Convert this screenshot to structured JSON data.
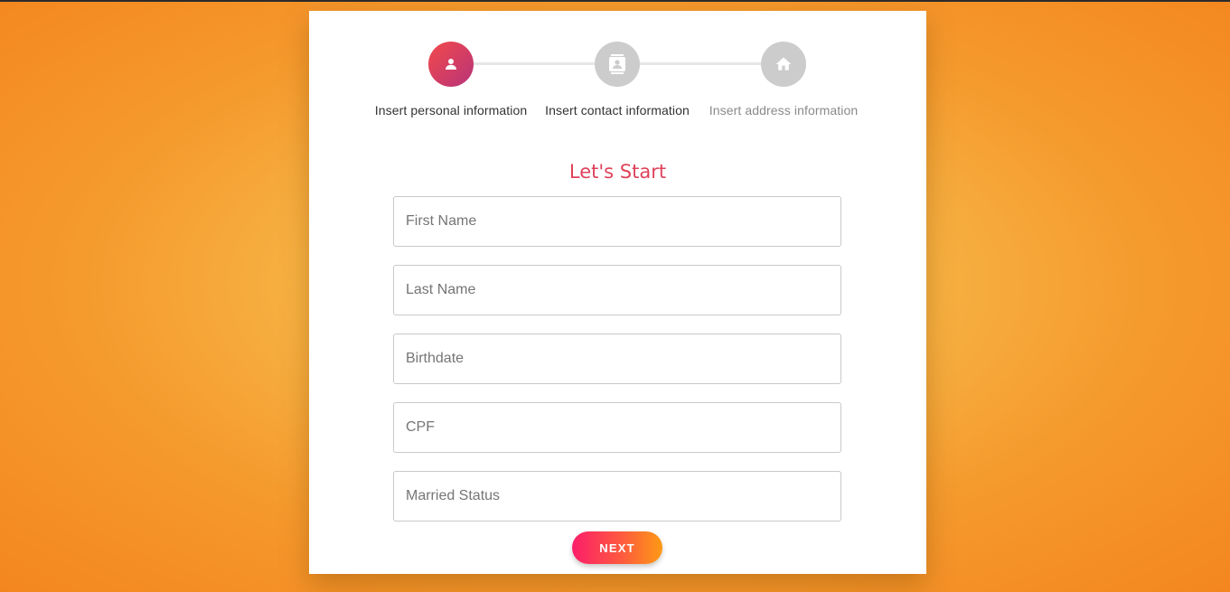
{
  "stepper": {
    "steps": [
      {
        "label": "Insert personal information",
        "icon": "person-icon",
        "state": "active"
      },
      {
        "label": "Insert contact information",
        "icon": "contact-card-icon",
        "state": "upcoming"
      },
      {
        "label": "Insert address information",
        "icon": "home-icon",
        "state": "upcoming"
      }
    ]
  },
  "form": {
    "title": "Let's Start",
    "fields": [
      {
        "name": "first-name",
        "placeholder": "First Name",
        "value": ""
      },
      {
        "name": "last-name",
        "placeholder": "Last Name",
        "value": ""
      },
      {
        "name": "birthdate",
        "placeholder": "Birthdate",
        "value": ""
      },
      {
        "name": "cpf",
        "placeholder": "CPF",
        "value": ""
      },
      {
        "name": "married-status",
        "placeholder": "Married Status",
        "value": ""
      }
    ],
    "next_label": "NEXT"
  },
  "colors": {
    "accent_title": "#e0425b",
    "active_step_gradient": [
      "#f2494a",
      "#b8347a"
    ],
    "inactive_step": "#cccccc",
    "button_gradient": [
      "#fc1d6a",
      "#fd9a14"
    ],
    "background": [
      "#f6c150",
      "#f4861f"
    ]
  }
}
